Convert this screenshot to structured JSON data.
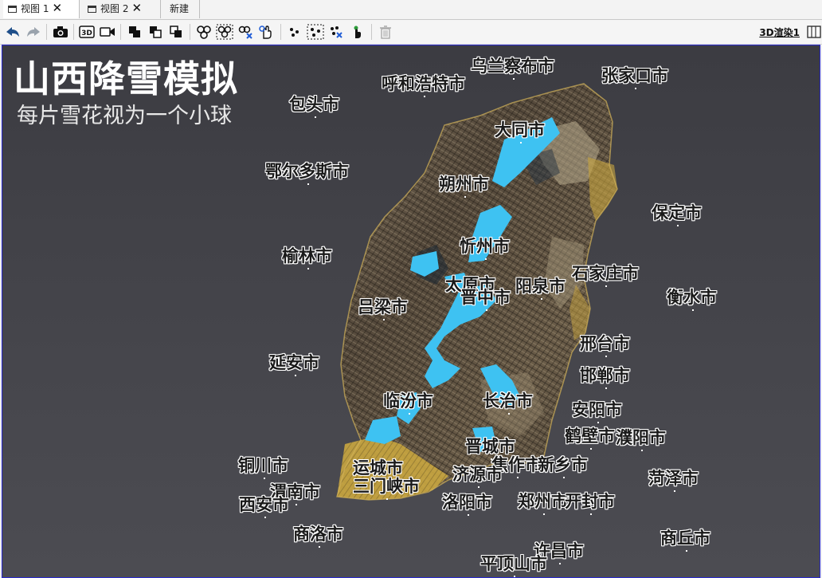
{
  "tabs": [
    {
      "label": "视图 1",
      "active": true
    },
    {
      "label": "视图 2",
      "active": false
    },
    {
      "label": "新建",
      "active": false
    }
  ],
  "toolbar": {
    "icons": [
      "back-icon",
      "forward-icon",
      "camera-icon",
      "3d-icon",
      "video-icon",
      "layer-front-icon",
      "layer-copy-icon",
      "layer-back-icon",
      "cluster-icon",
      "cluster-select-icon",
      "cluster-remove-icon",
      "hand-pointer-icon",
      "scatter-icon",
      "scatter-select-icon",
      "scatter-remove-icon",
      "touch-icon",
      "trash-icon"
    ],
    "render_label": "3D渲染1"
  },
  "viewport": {
    "title": "山西降雪模拟",
    "subtitle": "每片雪花视为一个小球",
    "colors": {
      "background": "#44444a",
      "snow": "#3ec2f2",
      "terrain_dark": "#3a3128",
      "terrain_light": "#b8ab8e",
      "lowland": "#c9a640"
    }
  },
  "cities": [
    {
      "name": "乌兰察布市"
    },
    {
      "name": "呼和浩特市"
    },
    {
      "name": "张家口市"
    },
    {
      "name": "包头市"
    },
    {
      "name": "大同市"
    },
    {
      "name": "鄂尔多斯市"
    },
    {
      "name": "朔州市"
    },
    {
      "name": "保定市"
    },
    {
      "name": "忻州市"
    },
    {
      "name": "榆林市"
    },
    {
      "name": "石家庄市"
    },
    {
      "name": "太原市"
    },
    {
      "name": "阳泉市"
    },
    {
      "name": "晋中市"
    },
    {
      "name": "衡水市"
    },
    {
      "name": "吕梁市"
    },
    {
      "name": "邢台市"
    },
    {
      "name": "延安市"
    },
    {
      "name": "邯郸市"
    },
    {
      "name": "临汾市"
    },
    {
      "name": "长治市"
    },
    {
      "name": "安阳市"
    },
    {
      "name": "鹤壁市"
    },
    {
      "name": "濮阳市"
    },
    {
      "name": "晋城市"
    },
    {
      "name": "铜川市"
    },
    {
      "name": "运城市"
    },
    {
      "name": "焦作市"
    },
    {
      "name": "新乡市"
    },
    {
      "name": "济源市"
    },
    {
      "name": "菏泽市"
    },
    {
      "name": "渭南市"
    },
    {
      "name": "三门峡市"
    },
    {
      "name": "西安市"
    },
    {
      "name": "洛阳市"
    },
    {
      "name": "郑州市"
    },
    {
      "name": "开封市"
    },
    {
      "name": "商洛市"
    },
    {
      "name": "商丘市"
    },
    {
      "name": "许昌市"
    },
    {
      "name": "平顶山市"
    }
  ]
}
